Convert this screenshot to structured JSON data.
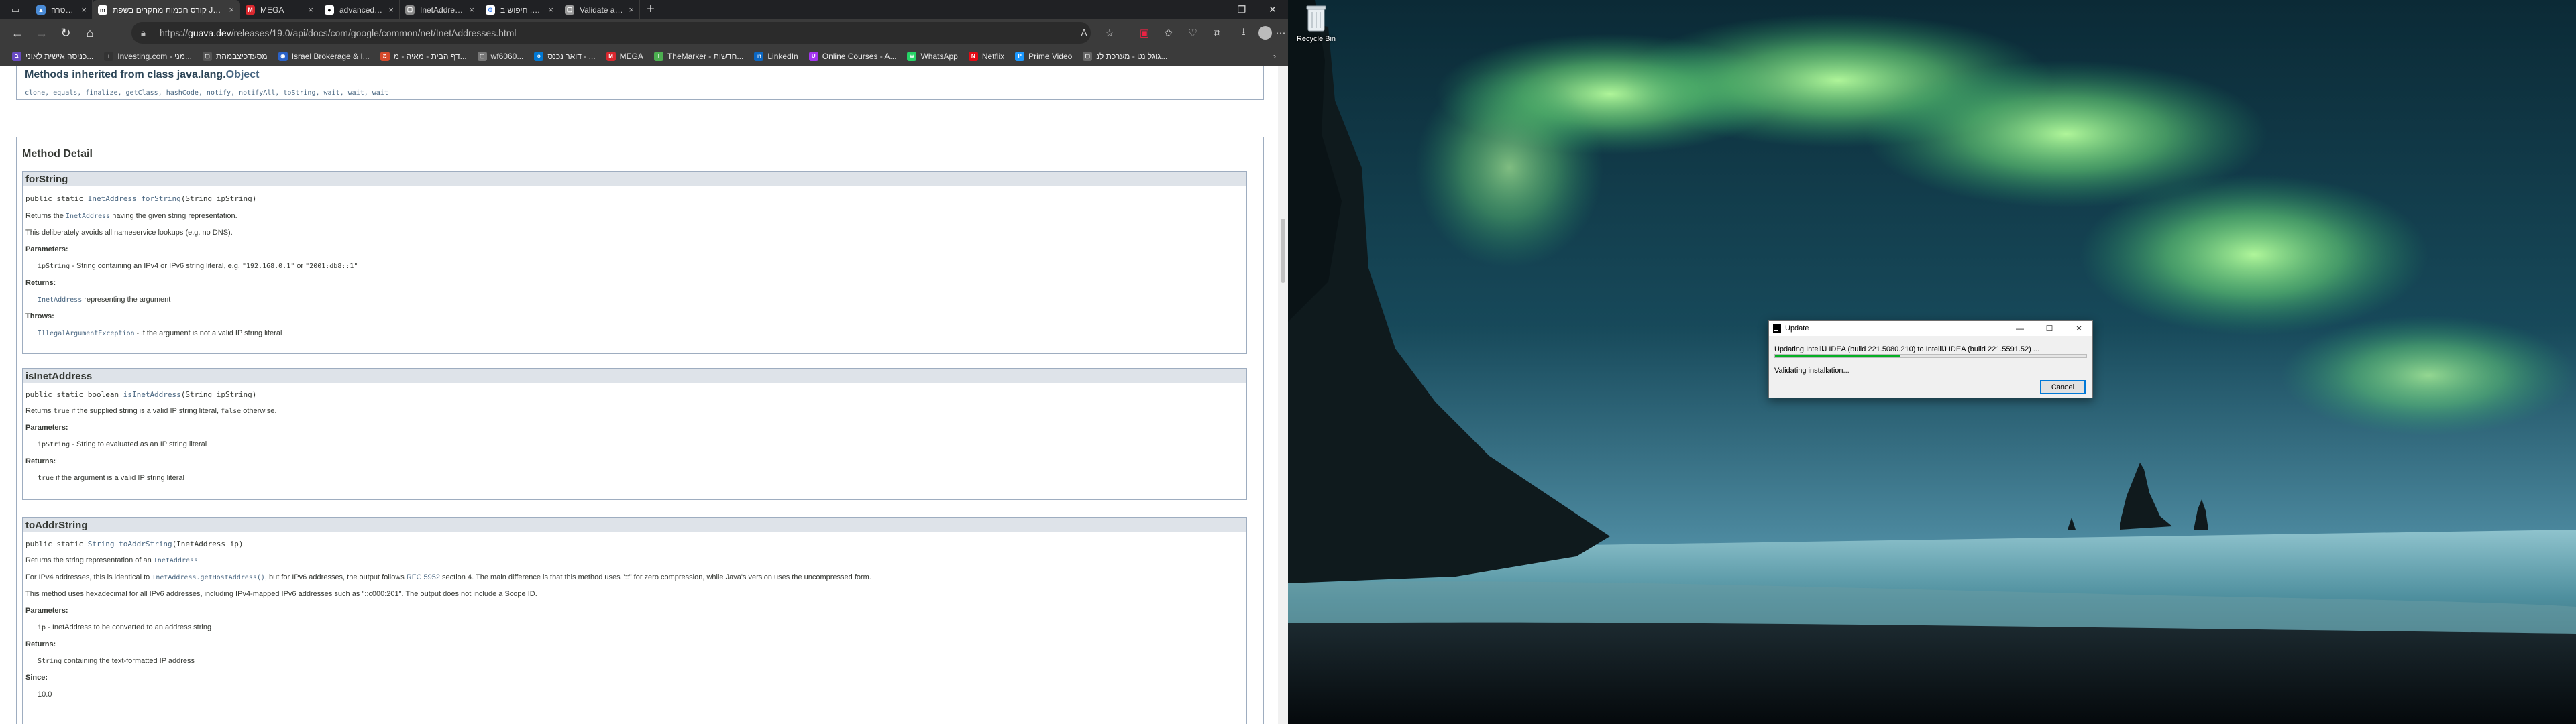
{
  "browser": {
    "tabs": [
      {
        "title": "ממטרה",
        "favicon_color": "#4a8bd6",
        "favicon_text": ""
      },
      {
        "title": "קורס חכמות מחקרים בשפת Java",
        "favicon_color": "#ffffff",
        "favicon_text": "m",
        "active": true
      },
      {
        "title": "MEGA",
        "favicon_color": "#d9272e",
        "favicon_text": "M"
      },
      {
        "title": "advanced-java/ChatController.j",
        "favicon_color": "#ffffff",
        "favicon_text": "●"
      },
      {
        "title": "InetAddresses (Guava: Google C",
        "favicon_color": "#888888",
        "favicon_text": "▢",
        "active_page": true
      },
      {
        "title": "חיפוש ב .nlo - Google",
        "favicon_color": "#ffffff",
        "favicon_text": "G"
      },
      {
        "title": "Validate an IP address in Java |",
        "favicon_color": "#999999",
        "favicon_text": "▢"
      }
    ],
    "url_prefix": "https://",
    "url_host": "guava.dev",
    "url_path": "/releases/19.0/api/docs/com/google/common/net/InetAddresses.html",
    "bookmarks": [
      {
        "label": "כניסה אישית לאוני...",
        "icon_color": "#6a4bc4",
        "icon_text": "ב"
      },
      {
        "label": "Investing.com - מני...",
        "icon_color": "#333333",
        "icon_text": "i"
      },
      {
        "label": "מסעדכיצבמהת",
        "icon_color": "#555555",
        "icon_text": "▢"
      },
      {
        "label": "Israel Brokerage & I...",
        "icon_color": "#2a62c8",
        "icon_text": "◉"
      },
      {
        "label": "דף הבית - מאיה - מ...",
        "icon_color": "#d44a2b",
        "icon_text": "מ"
      },
      {
        "label": "wf6060...",
        "icon_color": "#777777",
        "icon_text": "▢"
      },
      {
        "label": "דואר נכנס - ...",
        "icon_color": "#0078d4",
        "icon_text": "o"
      },
      {
        "label": "MEGA",
        "icon_color": "#d9272e",
        "icon_text": "M"
      },
      {
        "label": "TheMarker - חדשות...",
        "icon_color": "#4caf50",
        "icon_text": "T"
      },
      {
        "label": "LinkedIn",
        "icon_color": "#0a66c2",
        "icon_text": "in"
      },
      {
        "label": "Online Courses - A...",
        "icon_color": "#a435f0",
        "icon_text": "U"
      },
      {
        "label": "WhatsApp",
        "icon_color": "#25d366",
        "icon_text": "w"
      },
      {
        "label": "Netflix",
        "icon_color": "#e50914",
        "icon_text": "N"
      },
      {
        "label": "Prime Video",
        "icon_color": "#1a98ff",
        "icon_text": "P"
      },
      {
        "label": "גוגל נט - מערכת לנ...",
        "icon_color": "#666666",
        "icon_text": "▢"
      }
    ]
  },
  "javadoc": {
    "inherited_heading": "Methods inherited from class java.lang.",
    "inherited_class": "Object",
    "inherited_methods": "clone, equals, finalize, getClass, hashCode, notify, notifyAll, toString, wait, wait, wait",
    "method_detail_title": "Method Detail",
    "methods": [
      {
        "name": "forString",
        "sig_prefix": "public static ",
        "sig_return": "InetAddress",
        "sig_name": " forString",
        "sig_params": "(String ipString)",
        "desc1_pre": "Returns the ",
        "desc1_code": "InetAddress",
        "desc1_post": " having the given string representation.",
        "desc2": "This deliberately avoids all nameservice lookups (e.g. no DNS).",
        "params_label": "Parameters:",
        "param_name": "ipString",
        "param_type": " - String",
        "param_desc_pre": " containing an IPv4 or IPv6 string literal, e.g. ",
        "param_ex1": "\"192.168.0.1\"",
        "param_or": " or ",
        "param_ex2": "\"2001:db8::1\"",
        "returns_label": "Returns:",
        "returns_code": "InetAddress",
        "returns_text": " representing the argument",
        "throws_label": "Throws:",
        "throws_code": "IllegalArgumentException",
        "throws_text": " - if the argument is not a valid IP string literal"
      },
      {
        "name": "isInetAddress",
        "sig_prefix": "public static boolean ",
        "sig_name": "isInetAddress",
        "sig_params": "(String ipString)",
        "desc1_pre": "Returns ",
        "desc1_code": "true",
        "desc1_mid": " if the supplied string is a valid IP string literal, ",
        "desc1_code2": "false",
        "desc1_post": " otherwise.",
        "params_label": "Parameters:",
        "param_name": "ipString",
        "param_type": " - String",
        "param_desc": " to evaluated as an IP string literal",
        "returns_label": "Returns:",
        "returns_code": "true",
        "returns_text": " if the argument is a valid IP string literal"
      },
      {
        "name": "toAddrString",
        "sig_prefix": "public static ",
        "sig_return": "String",
        "sig_name": " toAddrString",
        "sig_params": "(InetAddress ip)",
        "desc1_pre": "Returns the string representation of an ",
        "desc1_code": "InetAddress",
        "desc1_post": ".",
        "desc2_pre": "For IPv4 addresses, this is identical to ",
        "desc2_code": "InetAddress.getHostAddress()",
        "desc2_mid": ", but for IPv6 addresses, the output follows ",
        "desc2_link": "RFC 5952",
        "desc2_post": " section 4. The main difference is that this method uses \"::\" for zero compression, while Java's version uses the uncompressed form.",
        "desc3": "This method uses hexadecimal for all IPv6 addresses, including IPv4-mapped IPv6 addresses such as \"::c000:201\". The output does not include a Scope ID.",
        "params_label": "Parameters:",
        "param_name": "ip",
        "param_type": " - InetAddress",
        "param_desc": " to be converted to an address string",
        "returns_label": "Returns:",
        "returns_code": "String",
        "returns_text": " containing the text-formatted IP address",
        "since_label": "Since:",
        "since_value": "10.0"
      }
    ]
  },
  "desktop": {
    "recycle_bin_label": "Recycle Bin"
  },
  "update_dialog": {
    "title": "Update",
    "message": "Updating IntelliJ IDEA (build 221.5080.210) to IntelliJ IDEA (build 221.5591.52) ...",
    "progress": 0.4,
    "status": "Validating installation...",
    "cancel_label": "Cancel"
  },
  "colors": {
    "javadoc_link": "#4a6782",
    "javadoc_header_bg": "#dee3e9",
    "progress_green": "#06b025",
    "cancel_focus_border": "#0078d7"
  }
}
